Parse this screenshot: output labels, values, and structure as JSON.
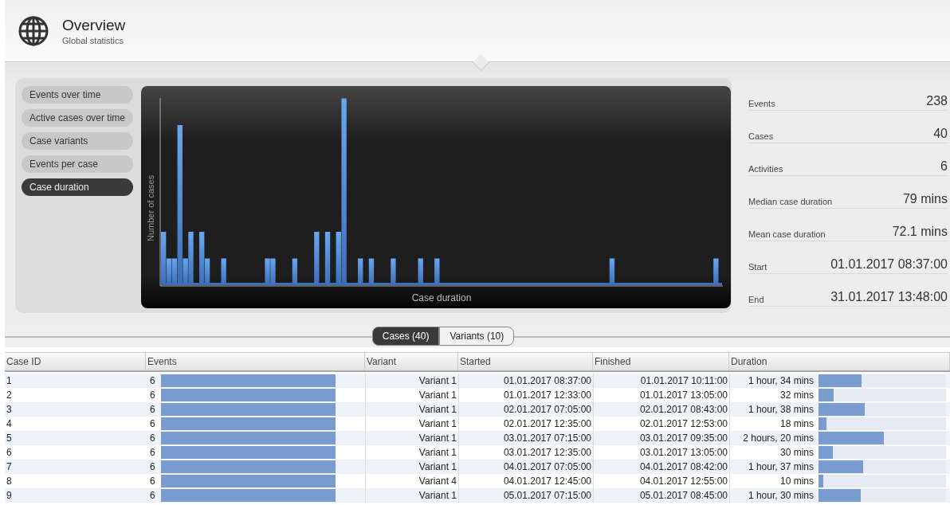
{
  "header": {
    "title": "Overview",
    "subtitle": "Global statistics"
  },
  "chart_menu": [
    {
      "label": "Events over time",
      "selected": false
    },
    {
      "label": "Active cases over time",
      "selected": false
    },
    {
      "label": "Case variants",
      "selected": false
    },
    {
      "label": "Events per case",
      "selected": false
    },
    {
      "label": "Case duration",
      "selected": true
    }
  ],
  "chart": {
    "ylabel": "Number of cases",
    "xlabel": "Case duration"
  },
  "stats": [
    {
      "label": "Events",
      "value": "238"
    },
    {
      "label": "Cases",
      "value": "40"
    },
    {
      "label": "Activities",
      "value": "6"
    },
    {
      "label": "Median case duration",
      "value": "79 mins"
    },
    {
      "label": "Mean case duration",
      "value": "72.1 mins"
    },
    {
      "label": "Start",
      "value": "01.01.2017 08:37:00"
    },
    {
      "label": "End",
      "value": "31.01.2017 13:48:00"
    }
  ],
  "tabs": [
    {
      "label": "Cases (40)",
      "selected": true
    },
    {
      "label": "Variants (10)",
      "selected": false
    }
  ],
  "table": {
    "columns": [
      "Case ID",
      "Events",
      "Variant",
      "Started",
      "Finished",
      "Duration"
    ],
    "rows": [
      {
        "case_id": "1",
        "events": "6",
        "variant": "Variant 1",
        "started": "01.01.2017 08:37:00",
        "finished": "01.01.2017 10:11:00",
        "duration": "1 hour, 34 mins",
        "level": 0.34
      },
      {
        "case_id": "2",
        "events": "6",
        "variant": "Variant 1",
        "started": "01.01.2017 12:33:00",
        "finished": "01.01.2017 13:05:00",
        "duration": "32 mins",
        "level": 0.12
      },
      {
        "case_id": "3",
        "events": "6",
        "variant": "Variant 1",
        "started": "02.01.2017 07:05:00",
        "finished": "02.01.2017 08:43:00",
        "duration": "1 hour, 38 mins",
        "level": 0.36
      },
      {
        "case_id": "4",
        "events": "6",
        "variant": "Variant 1",
        "started": "02.01.2017 12:35:00",
        "finished": "02.01.2017 12:53:00",
        "duration": "18 mins",
        "level": 0.065
      },
      {
        "case_id": "5",
        "events": "6",
        "variant": "Variant 1",
        "started": "03.01.2017 07:15:00",
        "finished": "03.01.2017 09:35:00",
        "duration": "2 hours, 20 mins",
        "level": 0.51
      },
      {
        "case_id": "6",
        "events": "6",
        "variant": "Variant 1",
        "started": "03.01.2017 12:35:00",
        "finished": "03.01.2017 13:05:00",
        "duration": "30 mins",
        "level": 0.11
      },
      {
        "case_id": "7",
        "events": "6",
        "variant": "Variant 1",
        "started": "04.01.2017 07:05:00",
        "finished": "04.01.2017 08:42:00",
        "duration": "1 hour, 37 mins",
        "level": 0.35
      },
      {
        "case_id": "8",
        "events": "6",
        "variant": "Variant 4",
        "started": "04.01.2017 12:45:00",
        "finished": "04.01.2017 12:55:00",
        "duration": "10 mins",
        "level": 0.036
      },
      {
        "case_id": "9",
        "events": "6",
        "variant": "Variant 1",
        "started": "05.01.2017 07:15:00",
        "finished": "05.01.2017 08:45:00",
        "duration": "1 hour, 30 mins",
        "level": 0.33
      }
    ]
  }
}
